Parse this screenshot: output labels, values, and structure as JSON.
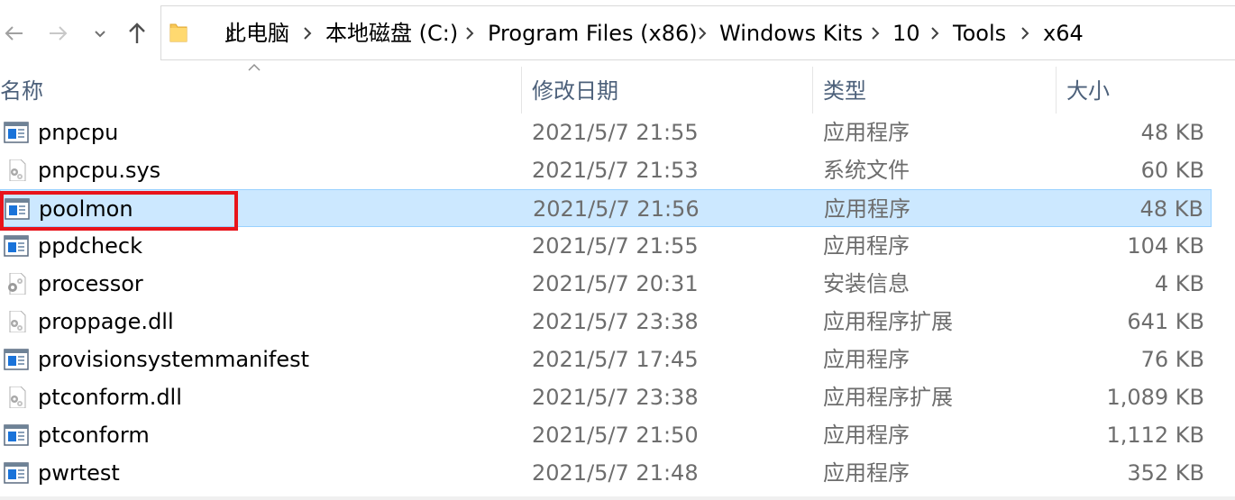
{
  "nav": {
    "back_icon": "arrow-left-icon",
    "forward_icon": "arrow-right-icon",
    "recent_icon": "chevron-down-icon",
    "up_icon": "arrow-up-icon"
  },
  "breadcrumb": {
    "folder_icon": "folder-icon",
    "items": [
      "此电脑",
      "本地磁盘 (C:)",
      "Program Files (x86)",
      "Windows Kits",
      "10",
      "Tools",
      "x64"
    ]
  },
  "columns": {
    "name": "名称",
    "date": "修改日期",
    "type": "类型",
    "size": "大小"
  },
  "files": [
    {
      "name": "pnpcpu",
      "date": "2021/5/7 21:55",
      "type": "应用程序",
      "size": "48 KB",
      "icon": "exe"
    },
    {
      "name": "pnpcpu.sys",
      "date": "2021/5/7 21:53",
      "type": "系统文件",
      "size": "60 KB",
      "icon": "gear-file"
    },
    {
      "name": "poolmon",
      "date": "2021/5/7 21:56",
      "type": "应用程序",
      "size": "48 KB",
      "icon": "exe",
      "selected": true
    },
    {
      "name": "ppdcheck",
      "date": "2021/5/7 21:55",
      "type": "应用程序",
      "size": "104 KB",
      "icon": "exe"
    },
    {
      "name": "processor",
      "date": "2021/5/7 20:31",
      "type": "安装信息",
      "size": "4 KB",
      "icon": "setup-info"
    },
    {
      "name": "proppage.dll",
      "date": "2021/5/7 23:38",
      "type": "应用程序扩展",
      "size": "641 KB",
      "icon": "gear-file"
    },
    {
      "name": "provisionsystemmanifest",
      "date": "2021/5/7 17:45",
      "type": "应用程序",
      "size": "76 KB",
      "icon": "exe"
    },
    {
      "name": "ptconform.dll",
      "date": "2021/5/7 23:38",
      "type": "应用程序扩展",
      "size": "1,089 KB",
      "icon": "gear-file"
    },
    {
      "name": "ptconform",
      "date": "2021/5/7 21:50",
      "type": "应用程序",
      "size": "1,112 KB",
      "icon": "exe"
    },
    {
      "name": "pwrtest",
      "date": "2021/5/7 21:48",
      "type": "应用程序",
      "size": "352 KB",
      "icon": "exe"
    }
  ],
  "colors": {
    "selection_bg": "#cce8ff",
    "selection_border": "#99d1ff",
    "highlight_box": "#e8141b",
    "header_text": "#4c607a"
  }
}
